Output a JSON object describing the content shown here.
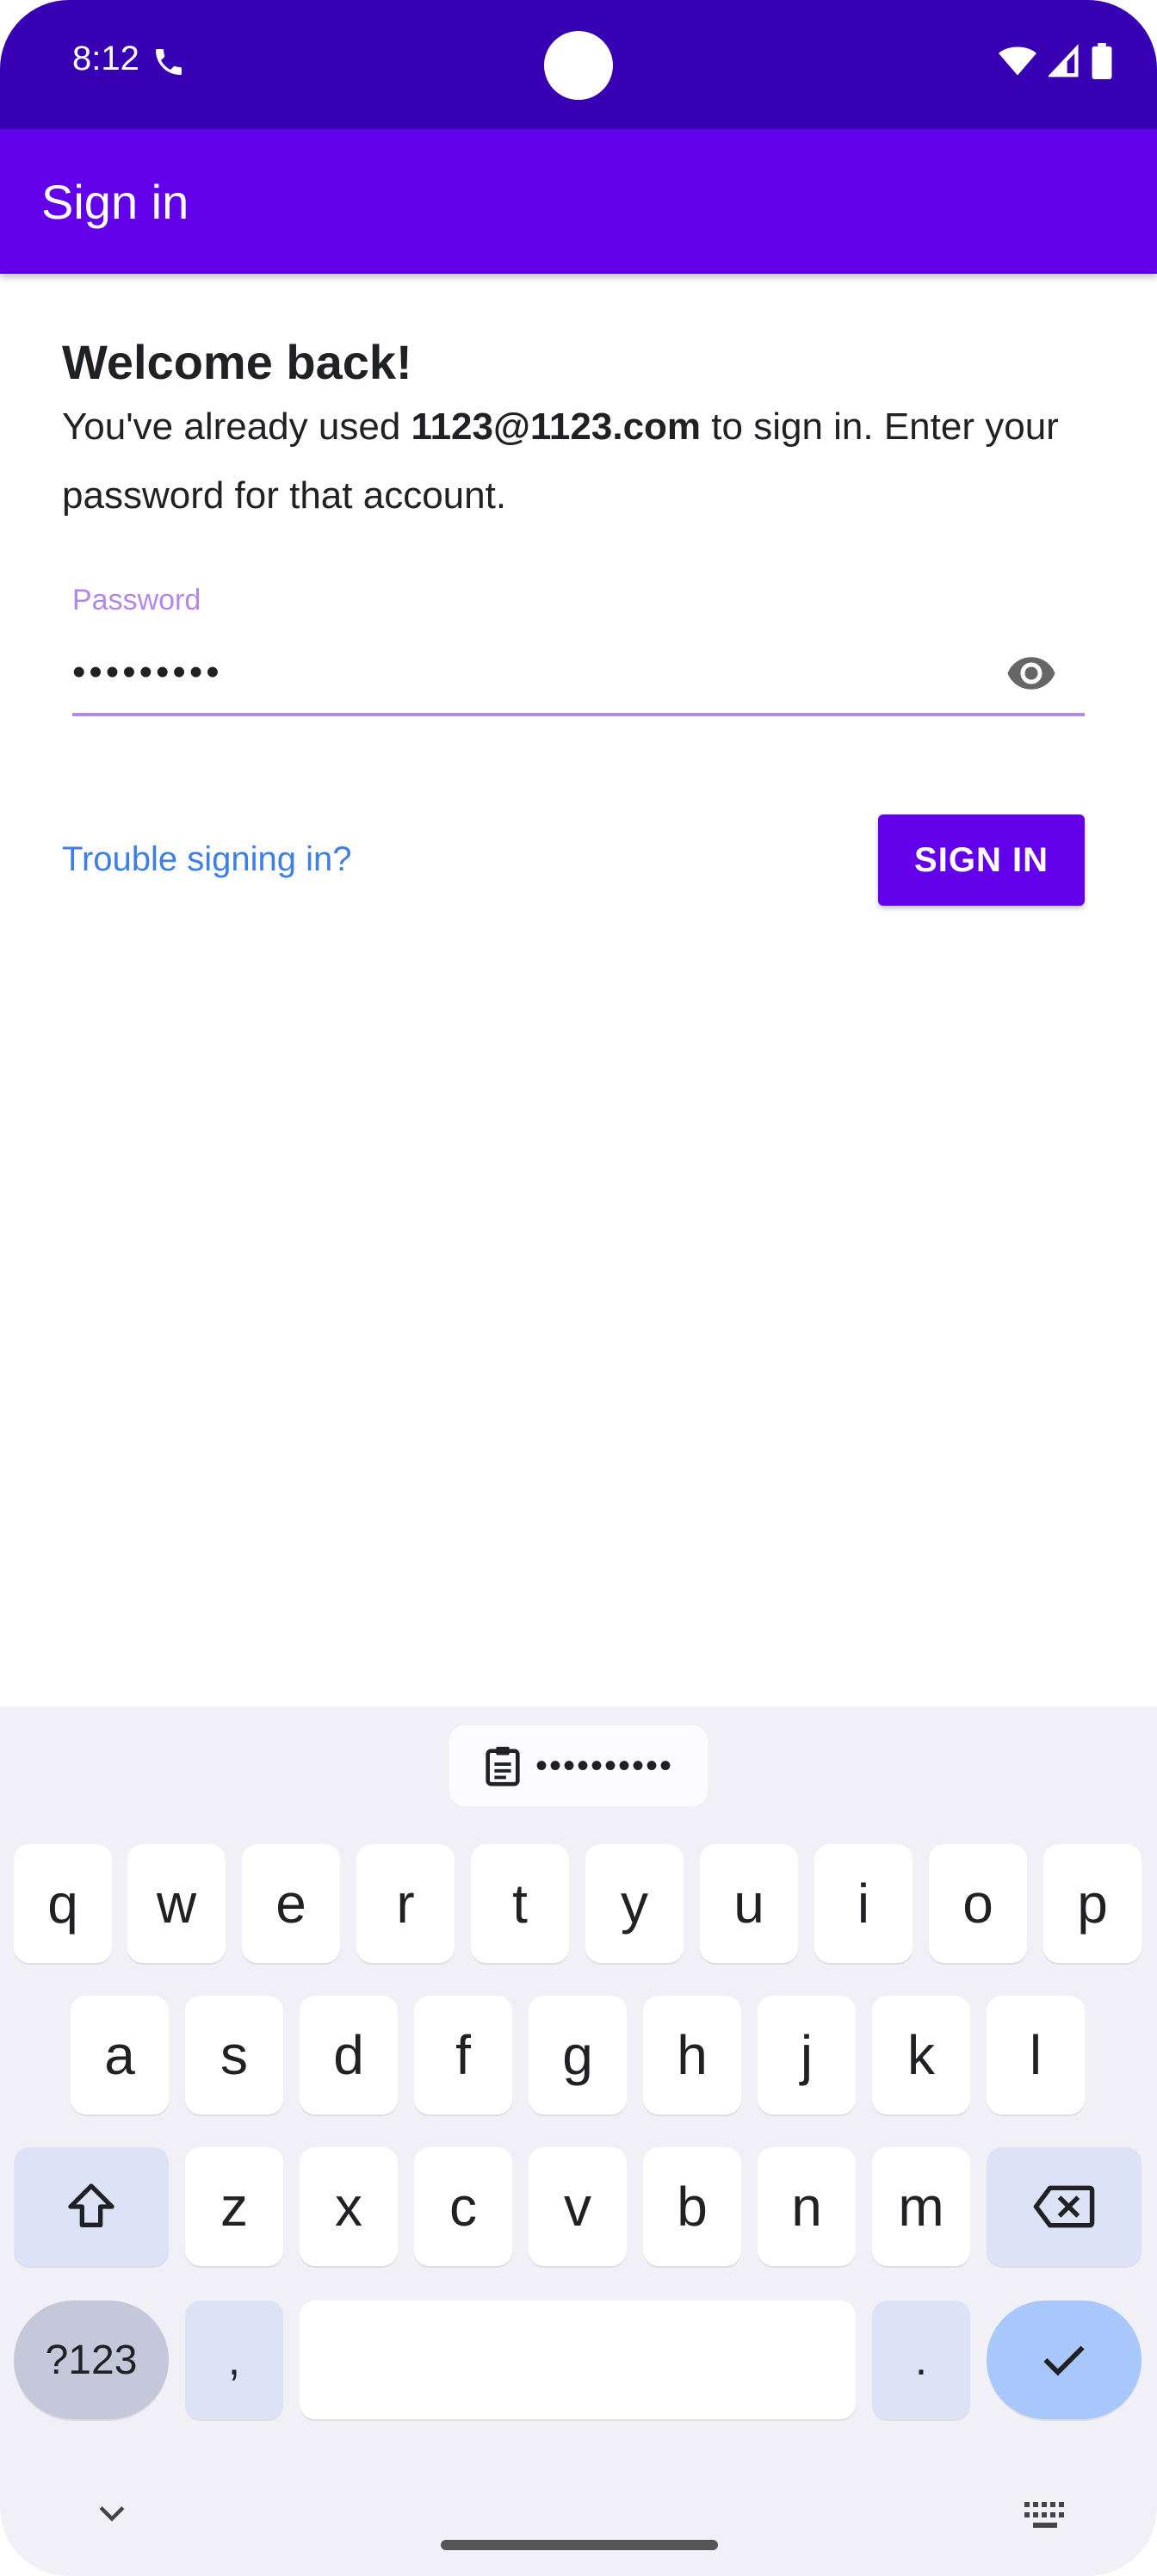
{
  "status_bar": {
    "time": "8:12",
    "phone_icon": "phone-icon",
    "wifi_icon": "wifi-icon",
    "signal_icon": "signal-icon",
    "battery_icon": "battery-icon"
  },
  "app_bar": {
    "title": "Sign in"
  },
  "content": {
    "heading": "Welcome back!",
    "desc_prefix": "You've already used ",
    "desc_email": "1123@1123.com",
    "desc_suffix": " to sign in. Enter your password for that account.",
    "password_label": "Password",
    "password_value": "•••••••••",
    "trouble_link": "Trouble signing in?",
    "sign_in_button": "SIGN IN"
  },
  "keyboard": {
    "clipboard_suggestion": "••••••••••",
    "row1": [
      "q",
      "w",
      "e",
      "r",
      "t",
      "y",
      "u",
      "i",
      "o",
      "p"
    ],
    "row2": [
      "a",
      "s",
      "d",
      "f",
      "g",
      "h",
      "j",
      "k",
      "l"
    ],
    "row3": [
      "z",
      "x",
      "c",
      "v",
      "b",
      "n",
      "m"
    ],
    "sym_key": "?123",
    "comma_key": ",",
    "period_key": "."
  },
  "colors": {
    "status_bar": "#3700b3",
    "app_bar": "#6200ea",
    "accent": "#b388eb",
    "link": "#3d7fe6"
  }
}
